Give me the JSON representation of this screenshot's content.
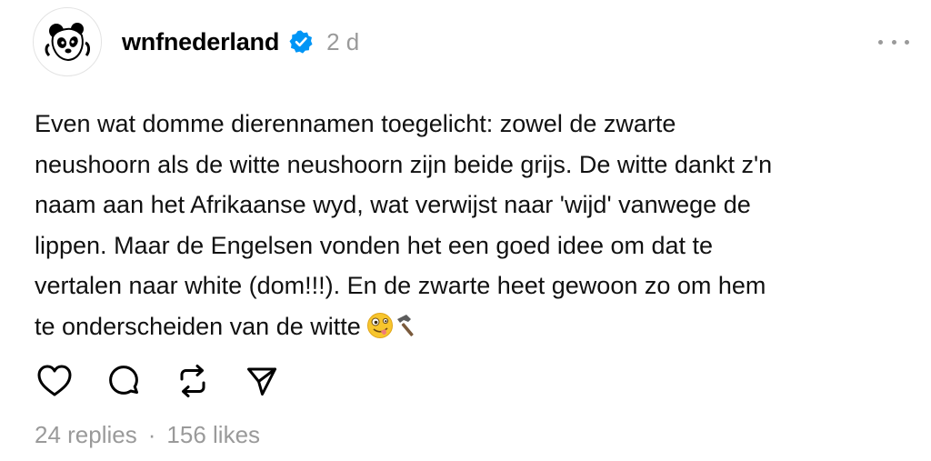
{
  "post": {
    "author": {
      "username": "wnfnederland",
      "verified": true,
      "avatar_icon": "panda-logo-icon"
    },
    "time_ago": "2 d",
    "text": "Even wat domme dierennamen toegelicht: zowel de zwarte\nneushoorn als de witte neushoorn zijn beide grijs. De witte dankt z'n\nnaam aan het Afrikaanse wyd, wat verwijst naar 'wijd' vanwege de\nlippen. Maar de Engelsen vonden het een goed idee om dat te\nvertalen naar white (dom!!!). En de zwarte heet gewoon zo om hem\nte onderscheiden van de witte",
    "emojis": [
      "zany-face-emoji",
      "hammer-emoji"
    ],
    "actions": [
      {
        "name": "like",
        "icon": "heart-icon"
      },
      {
        "name": "reply",
        "icon": "comment-icon"
      },
      {
        "name": "repost",
        "icon": "repost-icon"
      },
      {
        "name": "share",
        "icon": "send-icon"
      }
    ],
    "stats": {
      "replies": "24 replies",
      "separator": "·",
      "likes": "156 likes"
    }
  },
  "colors": {
    "verified_badge": "#0095f6",
    "muted_text": "#9a9a9a"
  }
}
